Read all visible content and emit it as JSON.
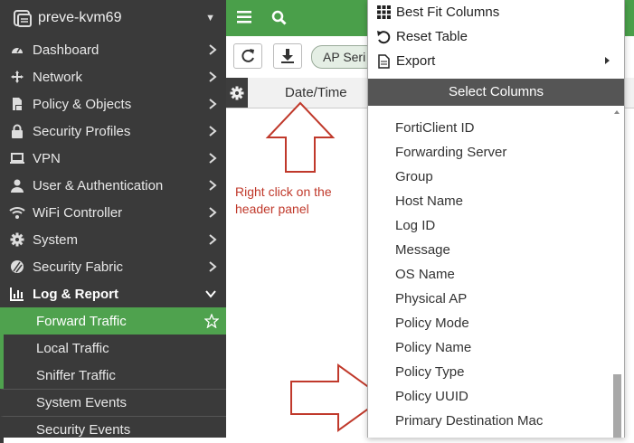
{
  "sidebar": {
    "device_name": "preve-kvm69",
    "items": [
      {
        "label": "Dashboard",
        "icon": "dashboard-icon"
      },
      {
        "label": "Network",
        "icon": "network-icon"
      },
      {
        "label": "Policy & Objects",
        "icon": "policy-icon"
      },
      {
        "label": "Security Profiles",
        "icon": "lock-icon"
      },
      {
        "label": "VPN",
        "icon": "laptop-icon"
      },
      {
        "label": "User & Authentication",
        "icon": "user-icon"
      },
      {
        "label": "WiFi Controller",
        "icon": "wifi-icon"
      },
      {
        "label": "System",
        "icon": "gear-icon"
      },
      {
        "label": "Security Fabric",
        "icon": "fabric-icon"
      },
      {
        "label": "Log & Report",
        "icon": "chart-icon"
      }
    ],
    "subitems": [
      {
        "label": "Forward Traffic"
      },
      {
        "label": "Local Traffic"
      },
      {
        "label": "Sniffer Traffic"
      },
      {
        "label": "System Events"
      },
      {
        "label": "Security Events"
      }
    ]
  },
  "toolbar": {
    "chip_label": "AP Seri"
  },
  "table": {
    "column_header": "Date/Time"
  },
  "annotation": {
    "text": "Right click on the header panel"
  },
  "context_menu": {
    "items": [
      {
        "label": "Best Fit Columns",
        "icon": "grid-icon"
      },
      {
        "label": "Reset Table",
        "icon": "undo-icon"
      },
      {
        "label": "Export",
        "icon": "document-icon"
      }
    ],
    "select_columns_label": "Select Columns",
    "columns": [
      "FortiClient ID",
      "Forwarding Server",
      "Group",
      "Host Name",
      "Log ID",
      "Message",
      "OS Name",
      "Physical AP",
      "Policy Mode",
      "Policy Name",
      "Policy Type",
      "Policy UUID",
      "Primary Destination Mac"
    ]
  },
  "colors": {
    "accent_green": "#4a9f4a",
    "sidebar_bg": "#3a3a3a",
    "annotation_red": "#c0392b"
  }
}
